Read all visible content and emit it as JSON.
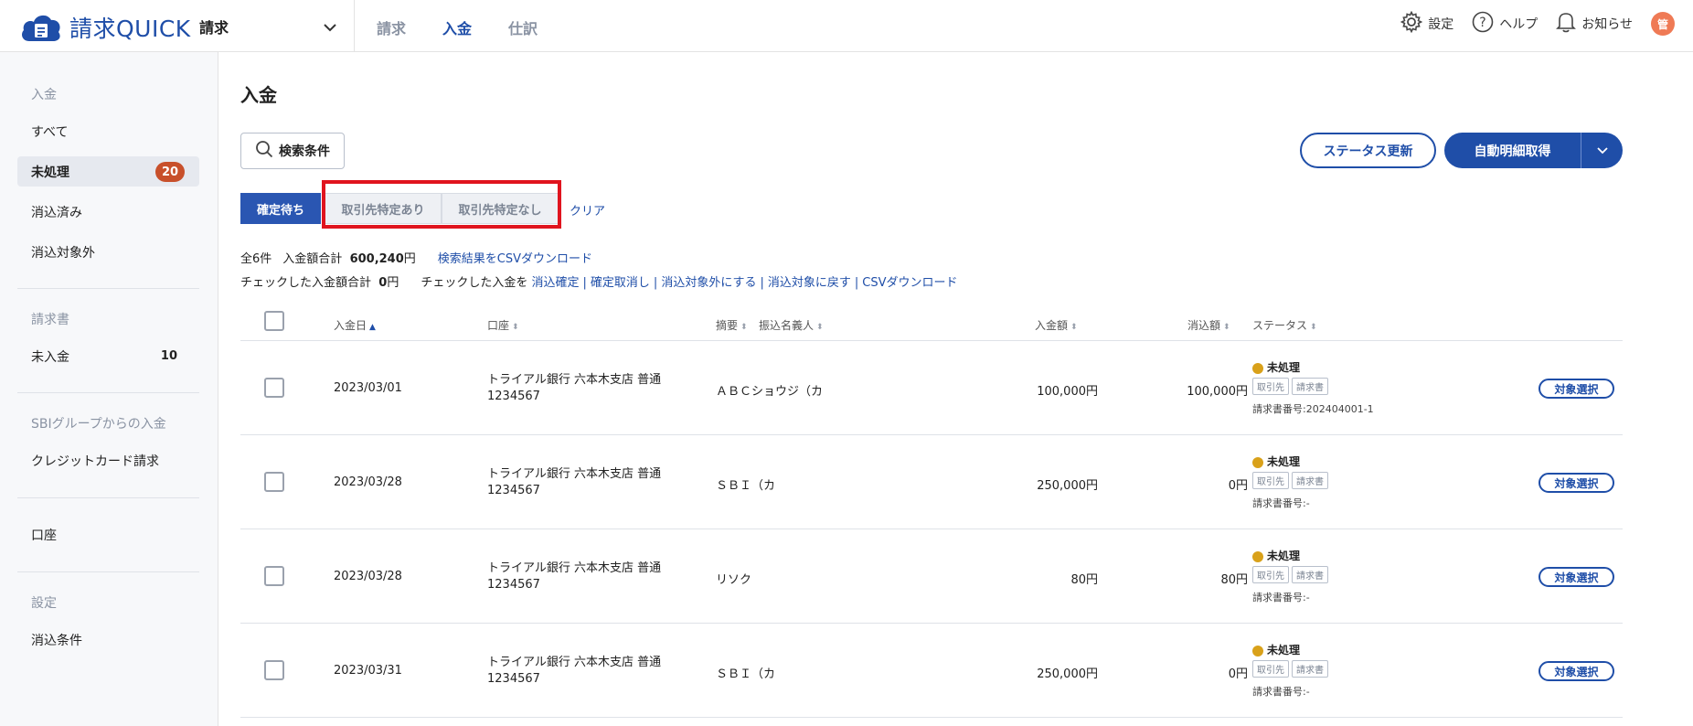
{
  "header": {
    "logo_text": "請求QUICK",
    "module": "請求",
    "nav": [
      "請求",
      "入金",
      "仕訳"
    ],
    "active_nav": "入金",
    "settings": "設定",
    "help": "ヘルプ",
    "notifications": "お知らせ",
    "avatar": "管",
    "accent": "#1f4ea8"
  },
  "sidebar": {
    "sec1": "入金",
    "all": "すべて",
    "unprocessed": "未処理",
    "unprocessed_count": "20",
    "cleared": "消込済み",
    "excluded": "消込対象外",
    "sec2": "請求書",
    "unpaid": "未入金",
    "unpaid_count": "10",
    "sec3": "SBIグループからの入金",
    "credit": "クレジットカード請求",
    "account": "口座",
    "sec4": "設定",
    "rules": "消込条件"
  },
  "main": {
    "title": "入金",
    "search_label": "検索条件",
    "status_update": "ステータス更新",
    "auto_fetch": "自動明細取得",
    "tabs": [
      "確定待ち",
      "取引先特定あり",
      "取引先特定なし"
    ],
    "clear": "クリア",
    "total_count": "全6件",
    "total_label": "入金額合計",
    "total_value": "600,240",
    "total_unit": "円",
    "csv_search": "検索結果をCSVダウンロード",
    "checked_total_label": "チェックした入金額合計",
    "checked_total_value": "0",
    "checked_unit": "円",
    "checked_action_label": "チェックした入金を",
    "actions": [
      "消込確定",
      "確定取消し",
      "消込対象外にする",
      "消込対象に戻す",
      "CSVダウンロード"
    ]
  },
  "table": {
    "headers": {
      "date": "入金日",
      "account": "口座",
      "summary": "摘要",
      "payer": "振込名義人",
      "amount": "入金額",
      "cleared": "消込額",
      "status": "ステータス"
    },
    "rows": [
      {
        "date": "2023/03/01",
        "account": "トライアル銀行 六本木支店 普通1234567",
        "payer": "ＡＢＣショウジ（カ",
        "amount": "100,000円",
        "cleared": "100,000円",
        "status": "未処理",
        "tag1": "取引先",
        "tag2": "請求書",
        "invoice": "請求書番号:202404001-1",
        "button": "対象選択"
      },
      {
        "date": "2023/03/28",
        "account": "トライアル銀行 六本木支店 普通1234567",
        "payer": "ＳＢＩ（カ",
        "amount": "250,000円",
        "cleared": "0円",
        "status": "未処理",
        "tag1": "取引先",
        "tag2": "請求書",
        "invoice": "請求書番号:-",
        "button": "対象選択"
      },
      {
        "date": "2023/03/28",
        "account": "トライアル銀行 六本木支店 普通1234567",
        "payer": "リソク",
        "amount": "80円",
        "cleared": "80円",
        "status": "未処理",
        "tag1": "取引先",
        "tag2": "請求書",
        "invoice": "請求書番号:-",
        "button": "対象選択"
      },
      {
        "date": "2023/03/31",
        "account": "トライアル銀行 六本木支店 普通1234567",
        "payer": "ＳＢＩ（カ",
        "amount": "250,000円",
        "cleared": "0円",
        "status": "未処理",
        "tag1": "取引先",
        "tag2": "請求書",
        "invoice": "請求書番号:-",
        "button": "対象選択"
      }
    ]
  }
}
